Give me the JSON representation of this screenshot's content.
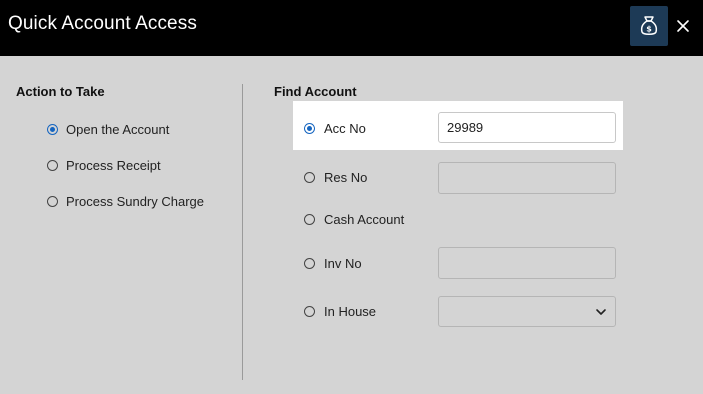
{
  "window": {
    "title": "Quick Account Access"
  },
  "toolbar": {
    "icons": [
      "money-bag-icon",
      "close-icon"
    ]
  },
  "action": {
    "title": "Action to Take",
    "options": [
      {
        "label": "Open the Account",
        "checked": true
      },
      {
        "label": "Process Receipt",
        "checked": false
      },
      {
        "label": "Process Sundry Charge",
        "checked": false
      }
    ]
  },
  "find": {
    "title": "Find Account",
    "options": [
      {
        "label": "Acc No",
        "checked": true,
        "value": "29989"
      },
      {
        "label": "Res No",
        "checked": false,
        "value": ""
      },
      {
        "label": "Cash Account",
        "checked": false
      },
      {
        "label": "Inv No",
        "checked": false,
        "value": ""
      },
      {
        "label": "In House",
        "checked": false,
        "selected": ""
      }
    ]
  },
  "colors": {
    "titlebar": "#000000",
    "accent": "#1565c0",
    "icon_button": "#1d3a56",
    "panel": "#d4d4d4"
  }
}
